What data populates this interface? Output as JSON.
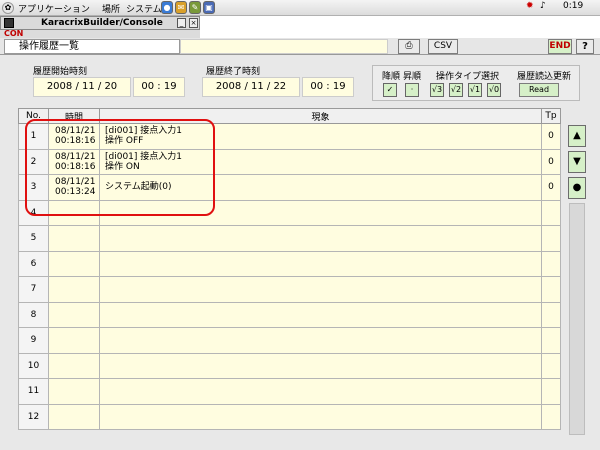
{
  "system_panel": {
    "foot_icon": "foot-icon",
    "menu": [
      "アプリケーション",
      "場所",
      "システム"
    ],
    "clock": "0:19"
  },
  "window": {
    "title": "KaracrixBuilder/Console",
    "toolbar_label": "CON"
  },
  "screen": {
    "title": "操作履歴一覧",
    "print_icon": "printer-icon",
    "csv_label": "CSV",
    "end_label": "END",
    "help_label": "?"
  },
  "filters": {
    "start_label": "履歴開始時刻",
    "start_date": "2008 / 11 / 20",
    "start_time": "00 : 19",
    "end_label": "履歴終了時刻",
    "end_date": "2008 / 11 / 22",
    "end_time": "00 : 19"
  },
  "options": {
    "desc_label": "降順",
    "asc_label": "昇順",
    "desc_checked": "✓",
    "asc_checked": "·",
    "type_label": "操作タイプ選択",
    "types": [
      "√3",
      "√2",
      "√1",
      "√0"
    ],
    "reload_label": "履歴読込更新",
    "read_button": "Read"
  },
  "table": {
    "headers": [
      "No.",
      "時間",
      "現象",
      "Tp"
    ],
    "rows": [
      {
        "no": "1",
        "time": "08/11/21\n00:18:16",
        "event": "[di001] 接点入力1\n操作 OFF",
        "tp": "0"
      },
      {
        "no": "2",
        "time": "08/11/21\n00:18:16",
        "event": "[di001] 接点入力1\n操作 ON",
        "tp": "0"
      },
      {
        "no": "3",
        "time": "08/11/21\n00:13:24",
        "event": "システム起動(0)",
        "tp": "0"
      },
      {
        "no": "4",
        "time": "",
        "event": "",
        "tp": ""
      },
      {
        "no": "5",
        "time": "",
        "event": "",
        "tp": ""
      },
      {
        "no": "6",
        "time": "",
        "event": "",
        "tp": ""
      },
      {
        "no": "7",
        "time": "",
        "event": "",
        "tp": ""
      },
      {
        "no": "8",
        "time": "",
        "event": "",
        "tp": ""
      },
      {
        "no": "9",
        "time": "",
        "event": "",
        "tp": ""
      },
      {
        "no": "10",
        "time": "",
        "event": "",
        "tp": ""
      },
      {
        "no": "11",
        "time": "",
        "event": "",
        "tp": ""
      },
      {
        "no": "12",
        "time": "",
        "event": "",
        "tp": ""
      }
    ]
  },
  "side_controls": {
    "up": "▲",
    "down": "▼",
    "center": "●"
  },
  "colors": {
    "highlight": "#e01010",
    "field_bg": "#fffde0",
    "button_green": "#d6f0c8",
    "end_text": "#c00000"
  }
}
